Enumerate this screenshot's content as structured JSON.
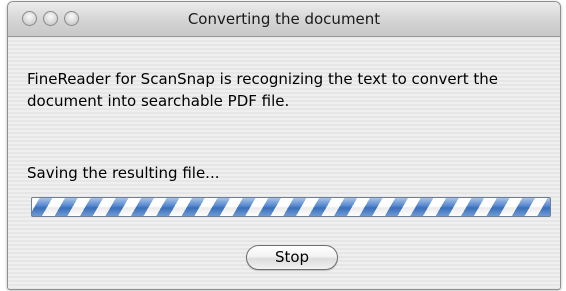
{
  "window": {
    "title": "Converting the document"
  },
  "dialog": {
    "message": "FineReader for ScanSnap is recognizing the text to convert the document into searchable PDF file.",
    "status": "Saving the resulting file...",
    "progress": "indeterminate",
    "stop_label": "Stop"
  },
  "colors": {
    "progress_stripe": "#3f78c9"
  }
}
